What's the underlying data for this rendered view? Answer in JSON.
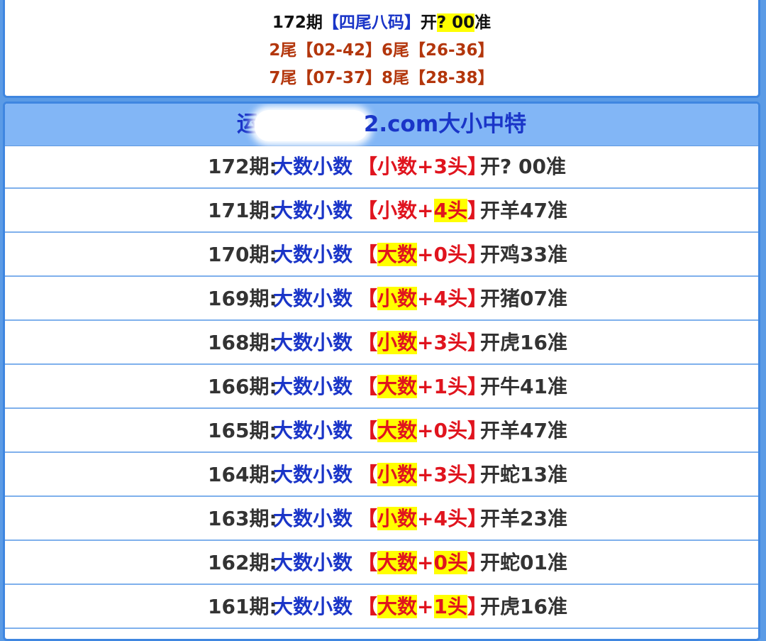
{
  "top": {
    "line1": {
      "prefix": "172期",
      "label": "【四尾八码】",
      "open": "开",
      "q": "? 00",
      "suffix": "准"
    },
    "line2": "2尾【02-42】6尾【26-36】",
    "line3": "7尾【07-37】8尾【28-38】"
  },
  "main": {
    "header": {
      "left": "运",
      "right": "2.com大小中特"
    },
    "rows": [
      {
        "issue": "172期:",
        "type": "大数小数",
        "b1": "【",
        "pred_word": "小数",
        "plus": "+",
        "digit": "3",
        "head": "头",
        "b2": "】",
        "open": "开",
        "result": "? 00",
        "suffix": "准"
      },
      {
        "issue": "171期:",
        "type": "大数小数",
        "b1": "【",
        "pred_word": "小数",
        "plus": "+",
        "digit": "4",
        "head": "头",
        "b2": "】",
        "open": "开",
        "result": "羊47",
        "suffix": "准"
      },
      {
        "issue": "170期:",
        "type": "大数小数",
        "b1": "【",
        "pred_word": "大数",
        "plus": "+",
        "digit": "0",
        "head": "头",
        "b2": "】",
        "open": "开",
        "result": "鸡33",
        "suffix": "准"
      },
      {
        "issue": "169期:",
        "type": "大数小数",
        "b1": "【",
        "pred_word": "小数",
        "plus": "+",
        "digit": "4",
        "head": "头",
        "b2": "】",
        "open": "开",
        "result": "猪07",
        "suffix": "准"
      },
      {
        "issue": "168期:",
        "type": "大数小数",
        "b1": "【",
        "pred_word": "小数",
        "plus": "+",
        "digit": "3",
        "head": "头",
        "b2": "】",
        "open": "开",
        "result": "虎16",
        "suffix": "准"
      },
      {
        "issue": "166期:",
        "type": "大数小数",
        "b1": "【",
        "pred_word": "大数",
        "plus": "+",
        "digit": "1",
        "head": "头",
        "b2": "】",
        "open": "开",
        "result": "牛41",
        "suffix": "准"
      },
      {
        "issue": "165期:",
        "type": "大数小数",
        "b1": "【",
        "pred_word": "大数",
        "plus": "+",
        "digit": "0",
        "head": "头",
        "b2": "】",
        "open": "开",
        "result": "羊47",
        "suffix": "准"
      },
      {
        "issue": "164期:",
        "type": "大数小数",
        "b1": "【",
        "pred_word": "小数",
        "plus": "+",
        "digit": "3",
        "head": "头",
        "b2": "】",
        "open": "开",
        "result": "蛇13",
        "suffix": "准"
      },
      {
        "issue": "163期:",
        "type": "大数小数",
        "b1": "【",
        "pred_word": "小数",
        "plus": "+",
        "digit": "4",
        "head": "头",
        "b2": "】",
        "open": "开",
        "result": "羊23",
        "suffix": "准"
      },
      {
        "issue": "162期:",
        "type": "大数小数",
        "b1": "【",
        "pred_word": "大数",
        "plus": "+",
        "digit": "0",
        "head": "头",
        "b2": "】",
        "open": "开",
        "result": "蛇01",
        "suffix": "准"
      },
      {
        "issue": "161期:",
        "type": "大数小数",
        "b1": "【",
        "pred_word": "大数",
        "plus": "+",
        "digit": "1",
        "head": "头",
        "b2": "】",
        "open": "开",
        "result": "虎16",
        "suffix": "准"
      }
    ]
  },
  "colors": {
    "accent_blue": "#1a35c8",
    "red": "#e0141e",
    "highlight": "#ffff00",
    "header_bg": "#82b6f6"
  }
}
